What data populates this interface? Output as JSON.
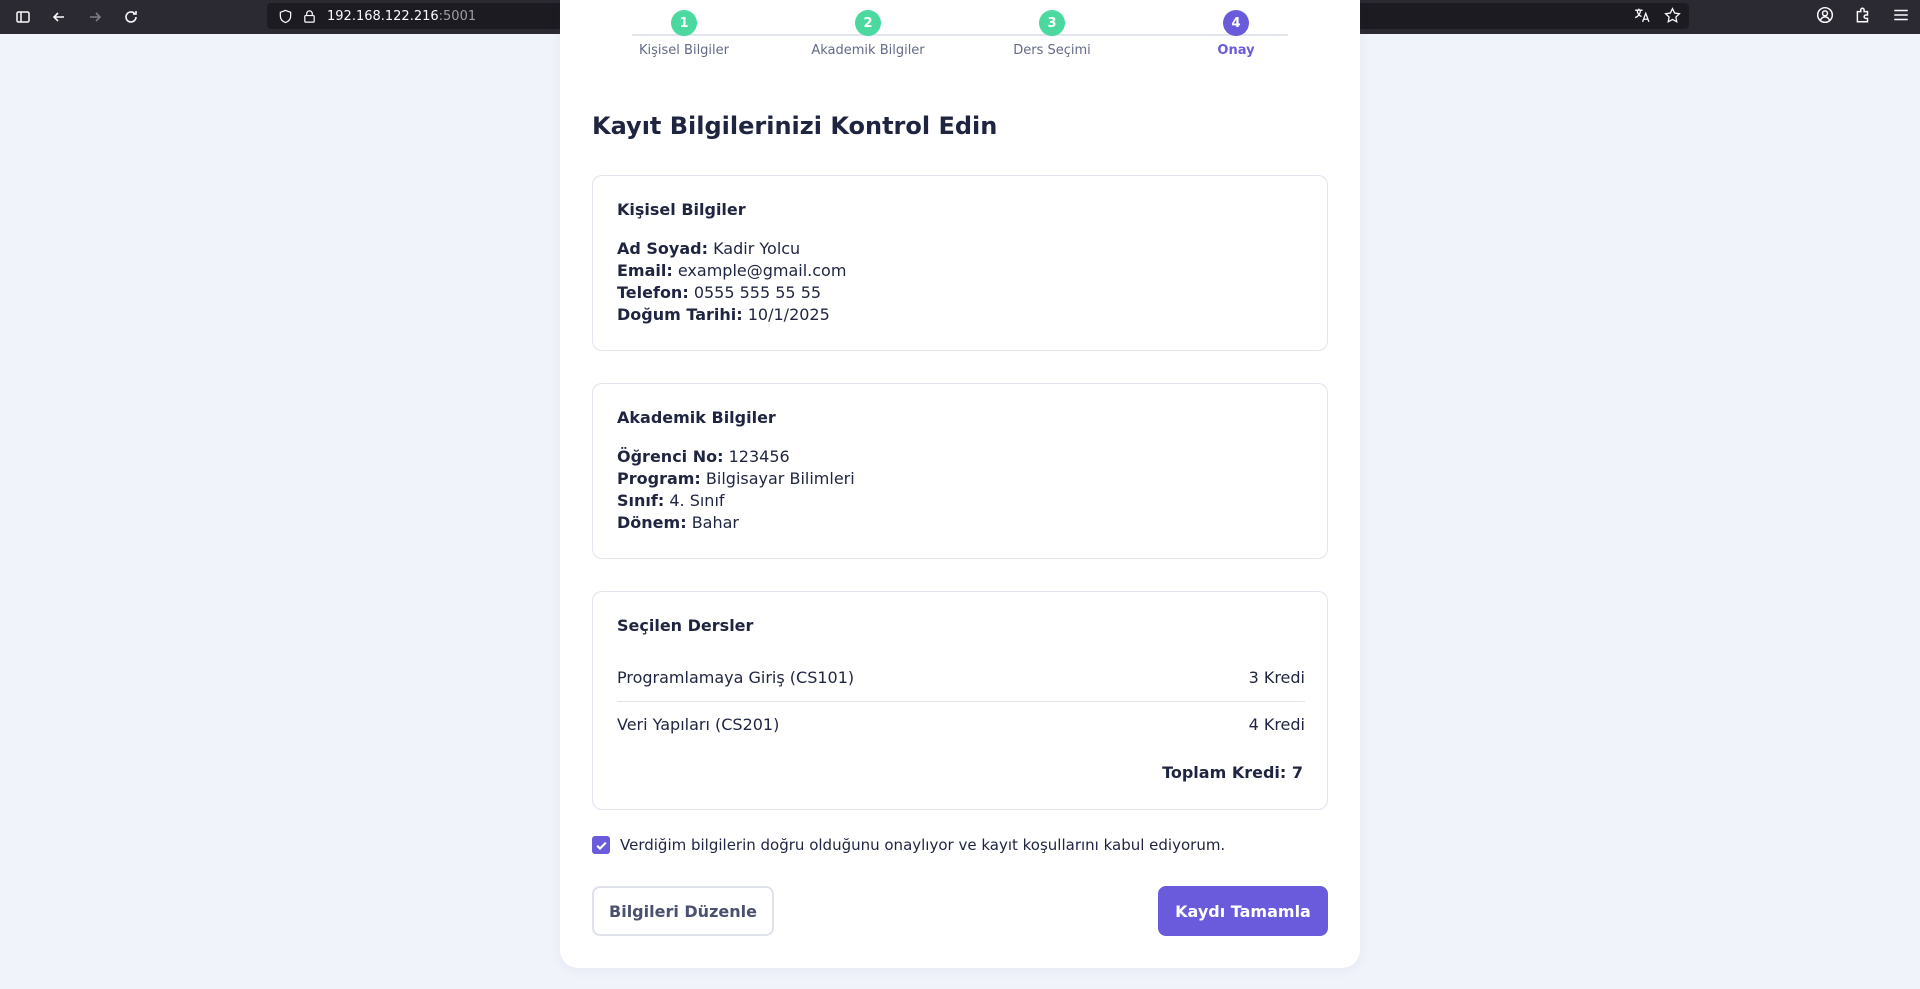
{
  "browser": {
    "url_host": "192.168.122.216",
    "url_port": ":5001"
  },
  "steps": [
    {
      "number": "1",
      "label": "Kişisel Bilgiler",
      "status": "done"
    },
    {
      "number": "2",
      "label": "Akademik Bilgiler",
      "status": "done"
    },
    {
      "number": "3",
      "label": "Ders Seçimi",
      "status": "done"
    },
    {
      "number": "4",
      "label": "Onay",
      "status": "active"
    }
  ],
  "page_title": "Kayıt Bilgilerinizi Kontrol Edin",
  "personal": {
    "title": "Kişisel Bilgiler",
    "name_label": "Ad Soyad:",
    "name_value": "Kadir Yolcu",
    "email_label": "Email:",
    "email_value": "example@gmail.com",
    "phone_label": "Telefon:",
    "phone_value": "0555 555 55 55",
    "birth_label": "Doğum Tarihi:",
    "birth_value": "10/1/2025"
  },
  "academic": {
    "title": "Akademik Bilgiler",
    "student_no_label": "Öğrenci No:",
    "student_no_value": "123456",
    "program_label": "Program:",
    "program_value": "Bilgisayar Bilimleri",
    "class_label": "Sınıf:",
    "class_value": "4. Sınıf",
    "term_label": "Dönem:",
    "term_value": "Bahar"
  },
  "courses": {
    "title": "Seçilen Dersler",
    "items": [
      {
        "name": "Programlamaya Giriş (CS101)",
        "credit": "3 Kredi"
      },
      {
        "name": "Veri Yapıları (CS201)",
        "credit": "4 Kredi"
      }
    ],
    "total": "Toplam Kredi: 7"
  },
  "agreement": {
    "checked": true,
    "text": "Verdiğim bilgilerin doğru olduğunu onaylıyor ve kayıt koşullarını kabul ediyorum."
  },
  "buttons": {
    "edit_label": "Bilgileri Düzenle",
    "complete_label": "Kaydı Tamamla"
  },
  "colors": {
    "accent": "#6a5bdc",
    "step_done": "#4cd9a0",
    "page_bg": "#f1f3fb"
  }
}
